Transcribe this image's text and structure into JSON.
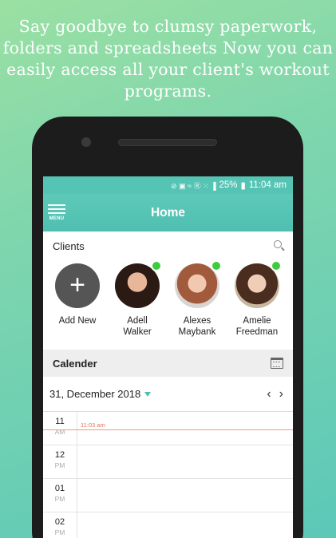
{
  "promo": {
    "line1": "Say goodbye to clumsy paperwork,",
    "line2": "folders and spreadsheets Now you can",
    "line3": "easily access all your client's workout",
    "line4": "programs."
  },
  "status": {
    "icons": "⊘ ▣ ≈ Ⓡ ⁙ ▐",
    "battery": "25%",
    "time": "11:04 am"
  },
  "appbar": {
    "menu_label": "MENU",
    "title": "Home"
  },
  "clients": {
    "heading": "Clients",
    "add_label": "Add New",
    "list": [
      {
        "first": "Adell",
        "last": "Walker"
      },
      {
        "first": "Alexes",
        "last": "Maybank"
      },
      {
        "first": "Amelie",
        "last": "Freedman"
      }
    ]
  },
  "calendar": {
    "heading": "Calender",
    "date": "31, December 2018",
    "prev": "‹",
    "next": "›",
    "now_label": "11:03 am"
  },
  "hours": [
    {
      "h": "11",
      "ap": "AM"
    },
    {
      "h": "12",
      "ap": "PM"
    },
    {
      "h": "01",
      "ap": "PM"
    },
    {
      "h": "02",
      "ap": "PM"
    }
  ],
  "colors": {
    "accent": "#4fbfb1",
    "online": "#3ecc3e",
    "now": "#e8745a"
  }
}
